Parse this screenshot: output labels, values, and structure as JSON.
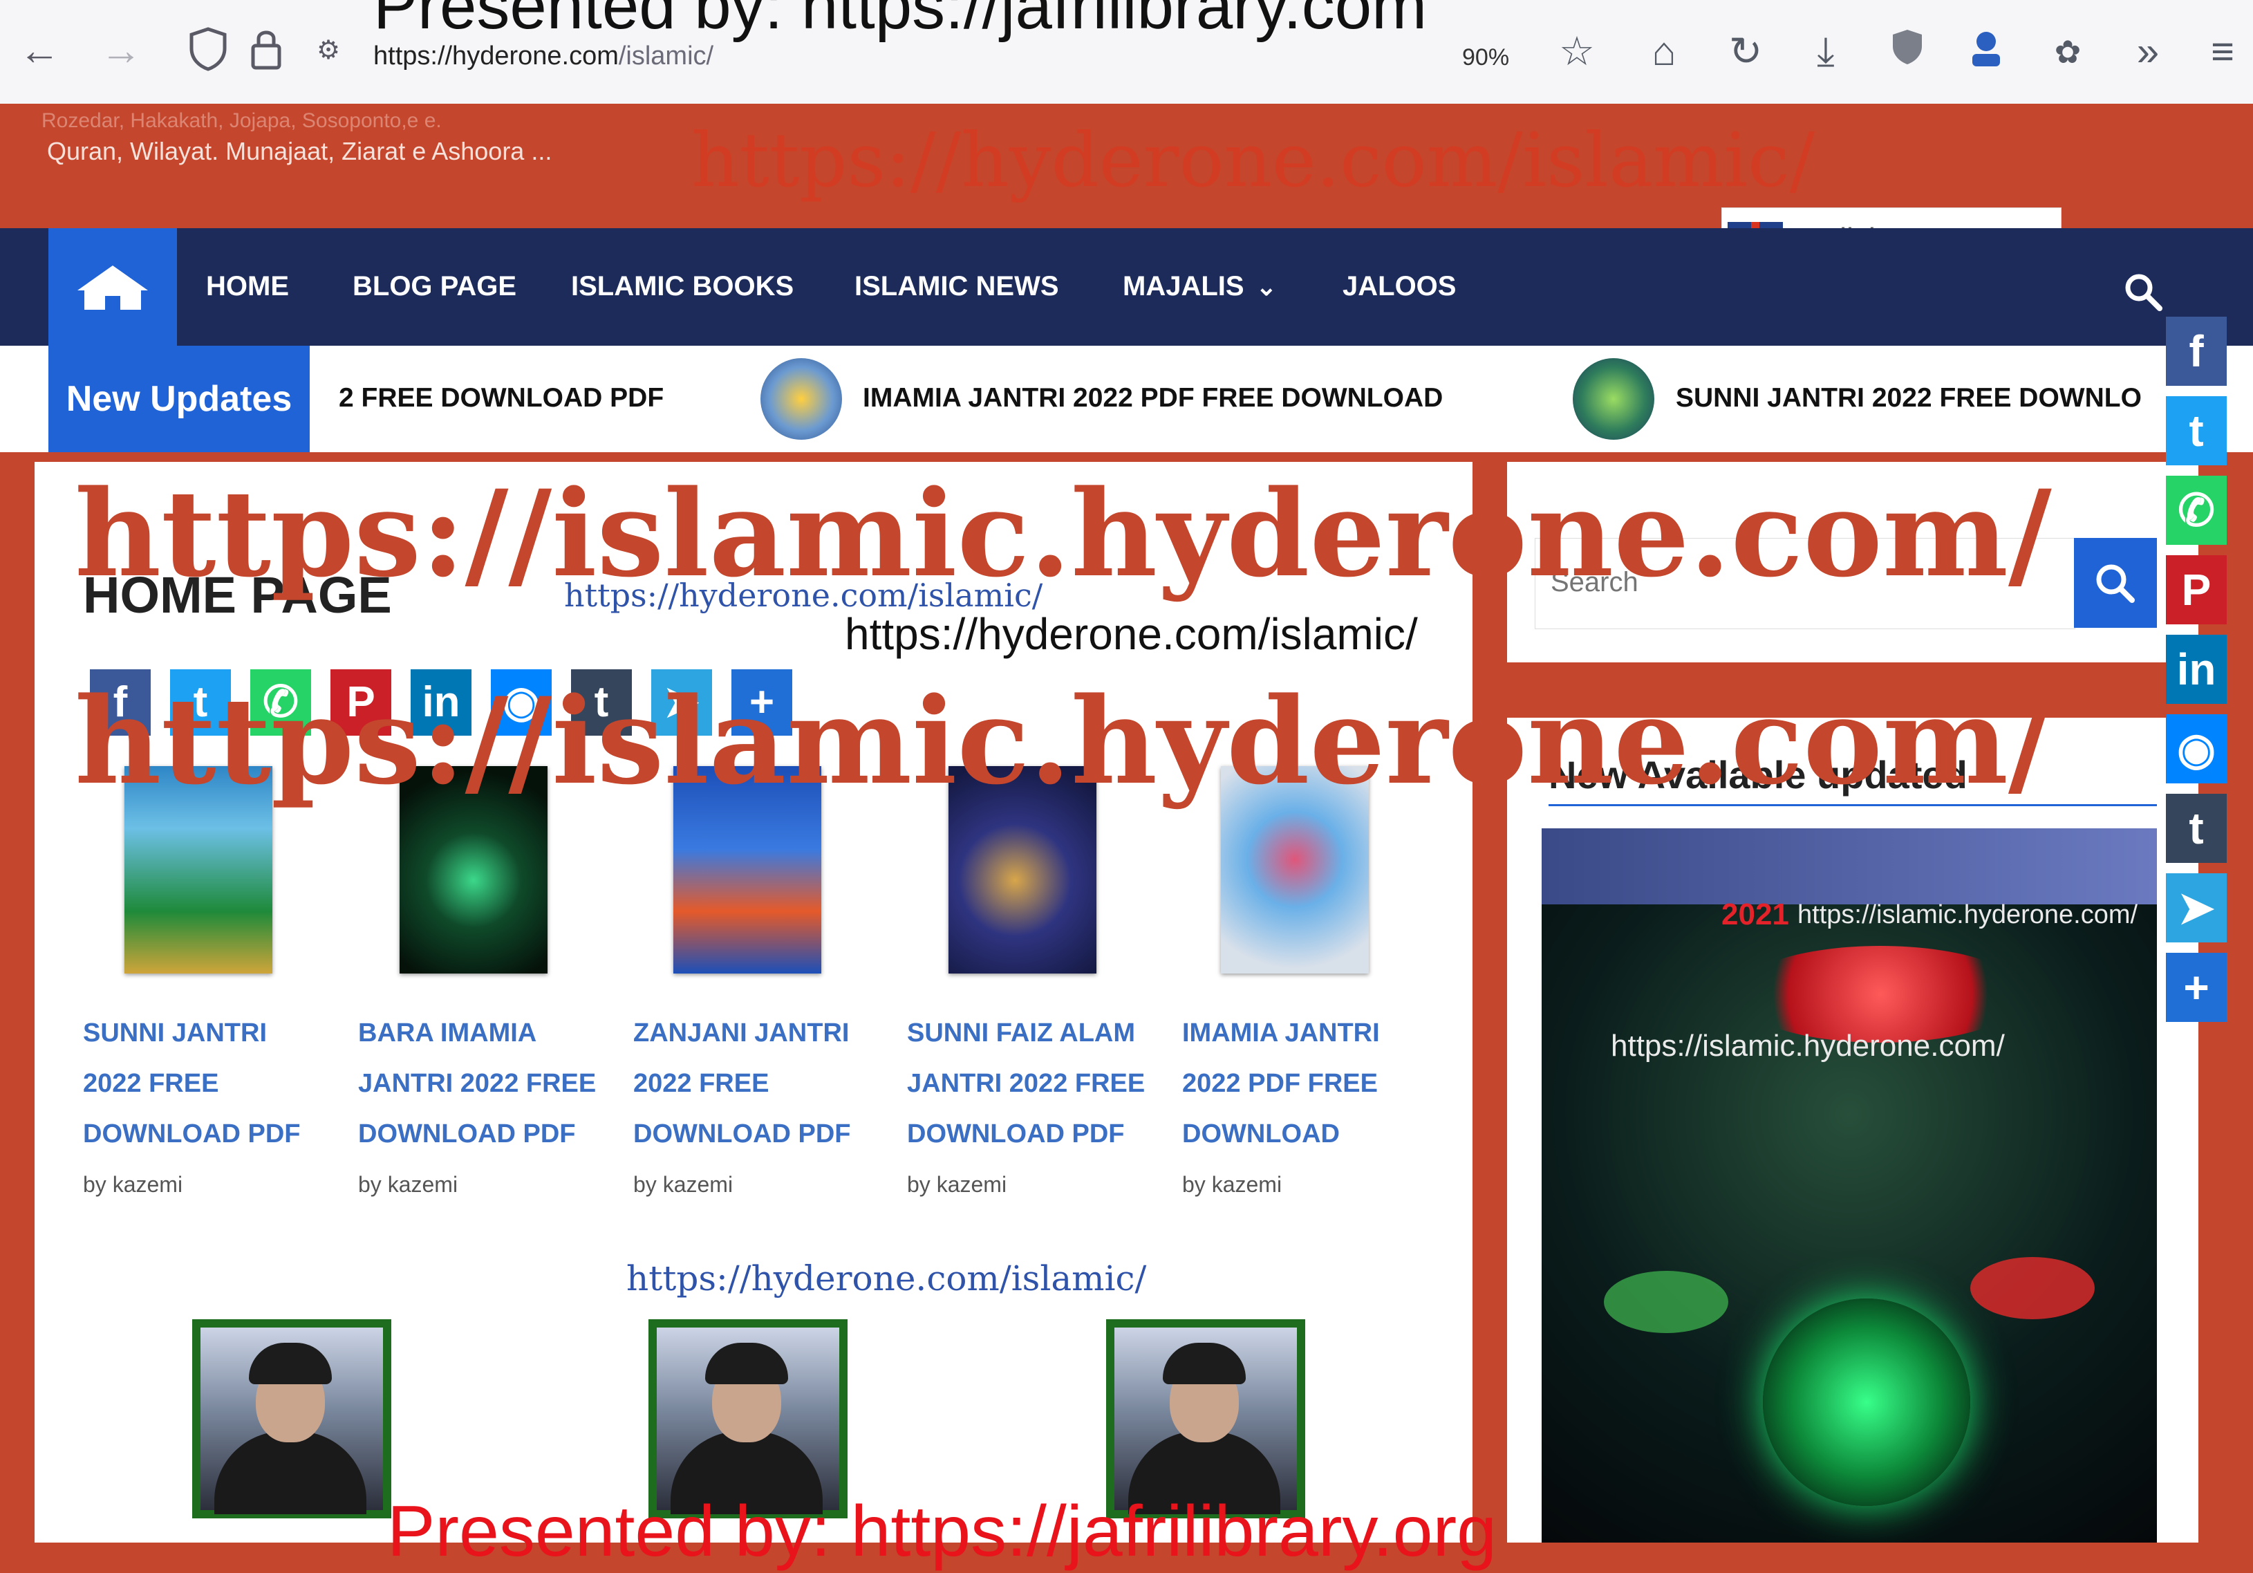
{
  "browser": {
    "url_host": "https://hyderone.com",
    "url_path": "/islamic/",
    "zoom": "90%"
  },
  "site": {
    "tagline_faded": "Rozedar, Hakakath, Jojapa, Sosoponto,e e.",
    "tagline": "Quran, Wilayat. Munajaat, Ziarat e Ashoora ...",
    "header_watermark": "https://hyderone.com/islamic/",
    "language": "English"
  },
  "nav": {
    "items": [
      "HOME",
      "BLOG PAGE",
      "ISLAMIC BOOKS",
      "ISLAMIC NEWS",
      "MAJALIS",
      "JALOOS"
    ]
  },
  "ticker": {
    "label": "New Updates",
    "items": [
      "2 FREE DOWNLOAD PDF",
      "IMAMIA JANTRI 2022 PDF FREE DOWNLOAD",
      "SUNNI JANTRI 2022 FREE DOWNLO"
    ]
  },
  "content": {
    "page_title": "HOME PAGE",
    "posts": [
      {
        "title": "SUNNI JANTRI 2022 FREE DOWNLOAD PDF",
        "author": "by kazemi"
      },
      {
        "title": "BARA IMAMIA JANTRI 2022 FREE DOWNLOAD PDF",
        "author": "by kazemi"
      },
      {
        "title": "ZANJANI JANTRI 2022 FREE DOWNLOAD PDF",
        "author": "by kazemi"
      },
      {
        "title": "SUNNI FAIZ ALAM JANTRI 2022 FREE DOWNLOAD PDF",
        "author": "by kazemi"
      },
      {
        "title": "IMAMIA JANTRI 2022 PDF FREE DOWNLOAD",
        "author": "by kazemi"
      }
    ]
  },
  "sidebar": {
    "search_placeholder": "Search",
    "heading": "New Available updated",
    "poster_url": "https://islamic.hyderone.com/",
    "poster_url2": "https://islamic.hyderone.com/",
    "poster_year": "2021"
  },
  "watermarks": {
    "top": "Presented by: https://jafrilibrary.com",
    "bottom": "Presented by: https://jafrilibrary.org",
    "big1": "https://islamic.hyderone.com/",
    "big2": "https://islamic.hyderone.com/",
    "serif1": "https://hyderone.com/islamic/",
    "plain1": "https://hyderone.com/islamic/",
    "serif2": "https://hyderone.com/islamic/"
  },
  "colors": {
    "brand_red": "#c4462c",
    "nav_navy": "#1d2b5a",
    "accent_blue": "#2063d6"
  }
}
